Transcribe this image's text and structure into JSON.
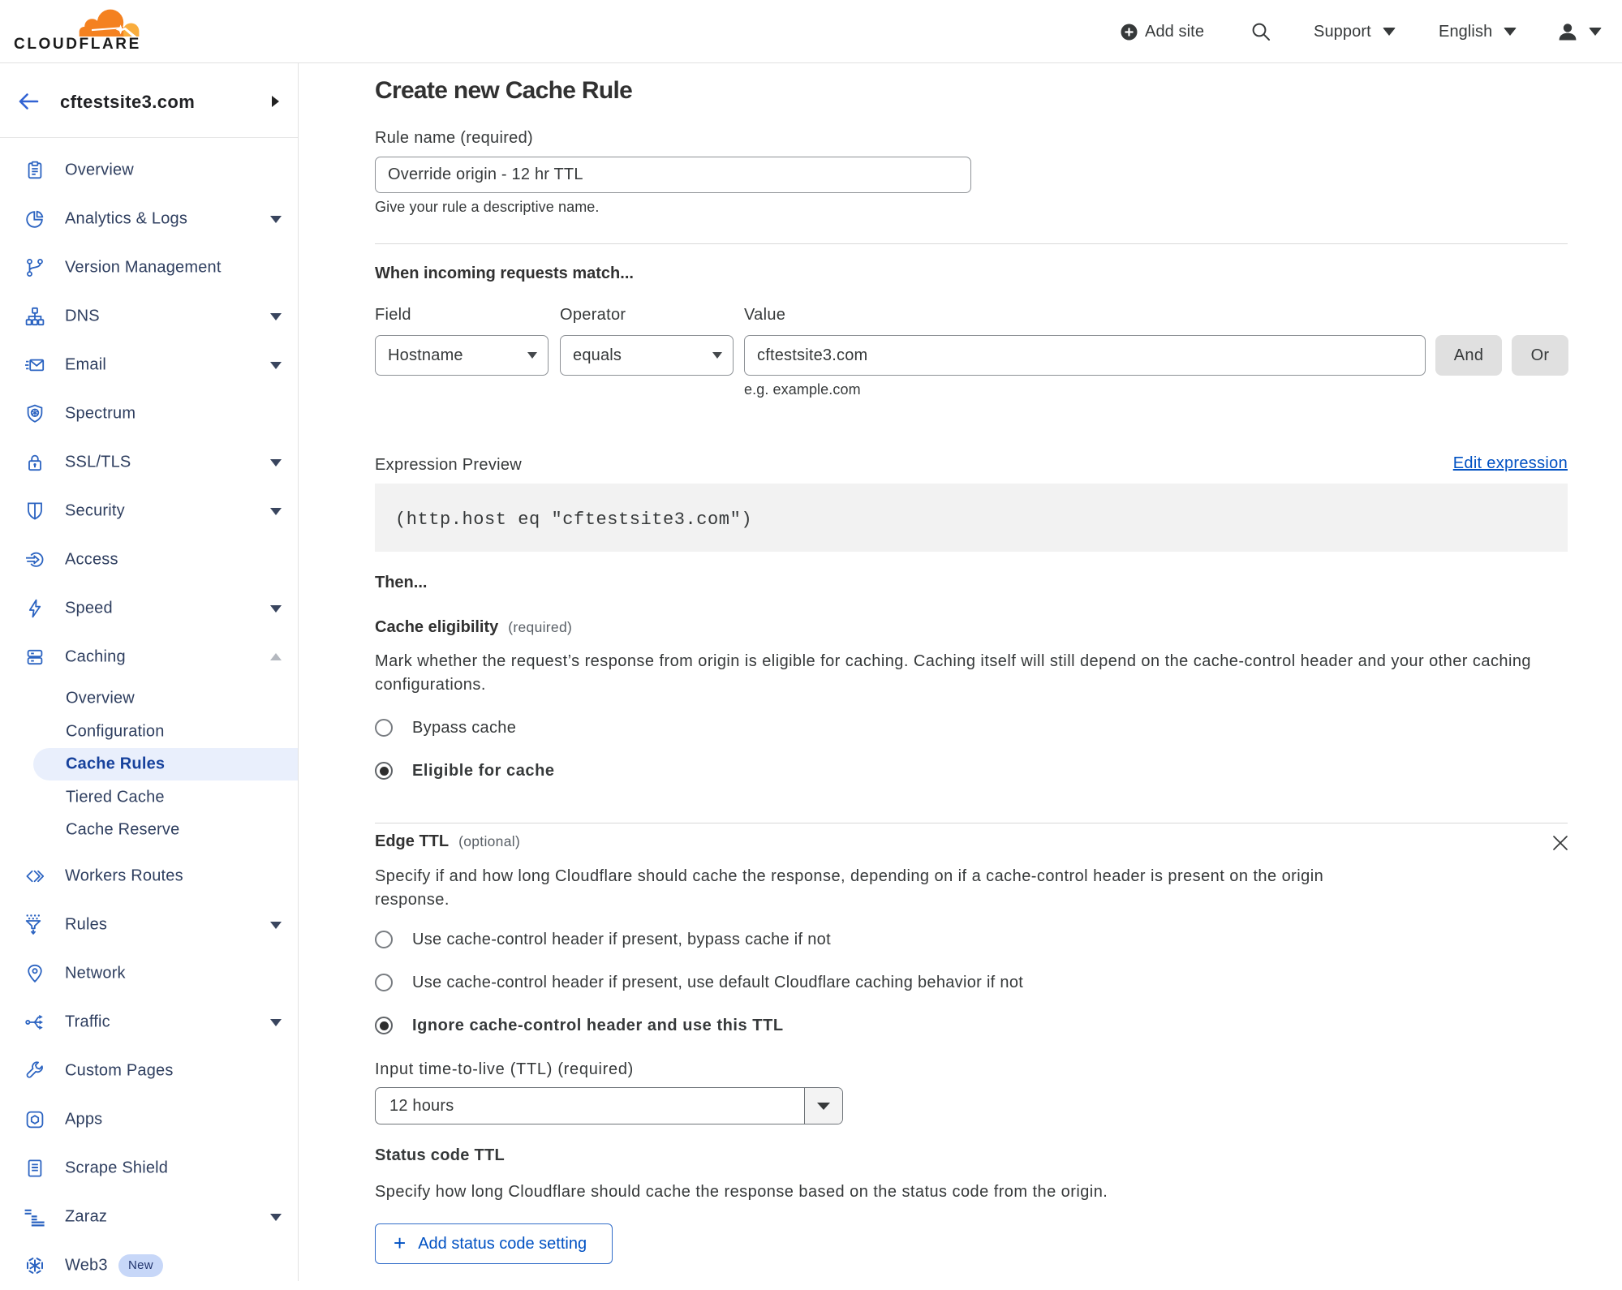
{
  "header": {
    "add_site": "Add site",
    "support": "Support",
    "language": "English",
    "logo_text": "CLOUDFLARE"
  },
  "sidebar": {
    "site": "cftestsite3.com",
    "items": [
      {
        "label": "Overview",
        "icon": "clipboard-icon"
      },
      {
        "label": "Analytics & Logs",
        "icon": "pie-chart-icon",
        "chevron": "down"
      },
      {
        "label": "Version Management",
        "icon": "git-branch-icon"
      },
      {
        "label": "DNS",
        "icon": "sitemap-icon",
        "chevron": "down"
      },
      {
        "label": "Email",
        "icon": "envelope-icon",
        "chevron": "down"
      },
      {
        "label": "Spectrum",
        "icon": "shield-star-icon"
      },
      {
        "label": "SSL/TLS",
        "icon": "padlock-icon",
        "chevron": "down"
      },
      {
        "label": "Security",
        "icon": "shield-icon",
        "chevron": "down"
      },
      {
        "label": "Access",
        "icon": "login-arrow-icon"
      },
      {
        "label": "Speed",
        "icon": "lightning-icon",
        "chevron": "down"
      },
      {
        "label": "Caching",
        "icon": "server-stack-icon",
        "chevron": "up"
      },
      {
        "label": "Overview",
        "sub": true
      },
      {
        "label": "Configuration",
        "sub": true
      },
      {
        "label": "Cache Rules",
        "sub": true,
        "active": true
      },
      {
        "label": "Tiered Cache",
        "sub": true
      },
      {
        "label": "Cache Reserve",
        "sub": true
      },
      {
        "label": "Workers Routes",
        "icon": "code-brackets-icon"
      },
      {
        "label": "Rules",
        "icon": "funnel-icon",
        "chevron": "down"
      },
      {
        "label": "Network",
        "icon": "map-pin-icon"
      },
      {
        "label": "Traffic",
        "icon": "branch-arrows-icon",
        "chevron": "down"
      },
      {
        "label": "Custom Pages",
        "icon": "wrench-icon"
      },
      {
        "label": "Apps",
        "icon": "app-box-icon"
      },
      {
        "label": "Scrape Shield",
        "icon": "document-icon"
      },
      {
        "label": "Zaraz",
        "icon": "zaraz-bars-icon",
        "chevron": "down"
      },
      {
        "label": "Web3",
        "icon": "web3-hexagon-icon",
        "badge": "New"
      }
    ]
  },
  "main": {
    "title": "Create new Cache Rule",
    "rule_name": {
      "label": "Rule name (required)",
      "value": "Override origin - 12 hr TTL",
      "helper": "Give your rule a descriptive name."
    },
    "match": {
      "heading": "When incoming requests match...",
      "field_label": "Field",
      "operator_label": "Operator",
      "value_label": "Value",
      "field_value": "Hostname",
      "operator_value": "equals",
      "value_value": "cftestsite3.com",
      "and_label": "And",
      "or_label": "Or",
      "value_helper": "e.g. example.com"
    },
    "expression": {
      "label": "Expression Preview",
      "edit_link": "Edit expression",
      "code": "(http.host eq \"cftestsite3.com\")"
    },
    "then_heading": "Then...",
    "eligibility": {
      "heading": "Cache eligibility",
      "required": "(required)",
      "description": "Mark whether the request’s response from origin is eligible for caching. Caching itself will still depend on the cache-control header and your other caching\nconfigurations.",
      "options": [
        {
          "label": "Bypass cache",
          "selected": false
        },
        {
          "label": "Eligible for cache",
          "selected": true
        }
      ]
    },
    "edge_ttl": {
      "heading": "Edge TTL",
      "optional": "(optional)",
      "description": "Specify if and how long Cloudflare should cache the response, depending on if a cache-control header is present on the origin\nresponse.",
      "options": [
        {
          "label": "Use cache-control header if present, bypass cache if not",
          "selected": false
        },
        {
          "label": "Use cache-control header if present, use default Cloudflare caching behavior if not",
          "selected": false
        },
        {
          "label": "Ignore cache-control header and use this TTL",
          "selected": true
        }
      ],
      "ttl_label": "Input time-to-live (TTL) (required)",
      "ttl_value": "12 hours",
      "status_heading": "Status code TTL",
      "status_description": "Specify how long Cloudflare should cache the response based on the status code from the origin.",
      "add_plus": "+",
      "add_button": "Add status code setting"
    }
  }
}
